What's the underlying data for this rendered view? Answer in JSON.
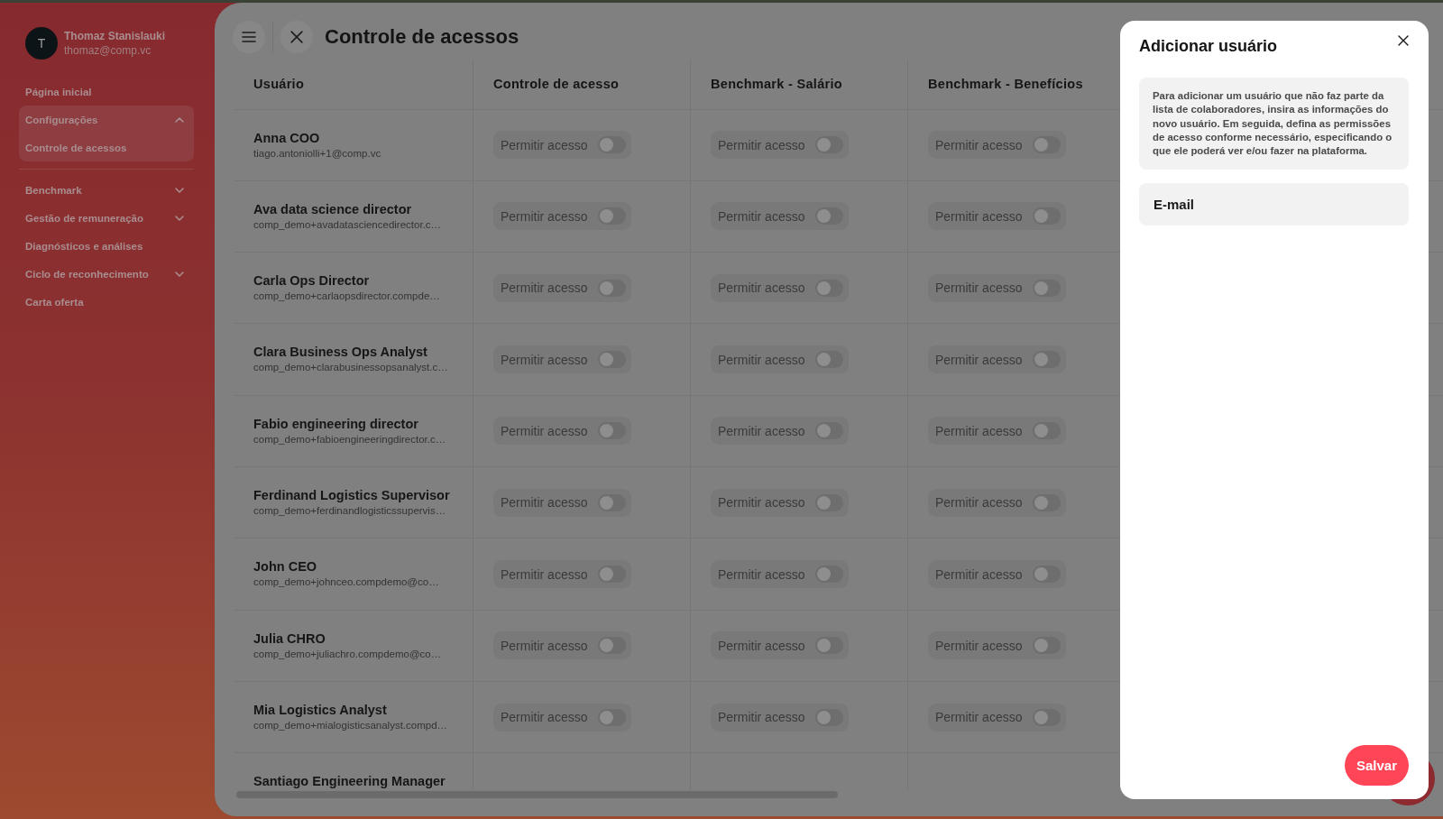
{
  "sidebar": {
    "user": {
      "initial": "T",
      "name": "Thomaz Stanislauki",
      "email": "thomaz@comp.vc"
    },
    "sections": [
      {
        "items": [
          {
            "kind": "link",
            "label": "Página inicial"
          },
          {
            "kind": "group",
            "label": "Configurações",
            "expanded": true,
            "children": [
              {
                "label": "Controle de acessos"
              }
            ]
          }
        ]
      },
      {
        "items": [
          {
            "kind": "group",
            "label": "Benchmark",
            "expanded": false
          },
          {
            "kind": "group",
            "label": "Gestão de remuneração",
            "expanded": false
          },
          {
            "kind": "link",
            "label": "Diagnósticos e análises"
          },
          {
            "kind": "group",
            "label": "Ciclo de reconhecimento",
            "expanded": false
          },
          {
            "kind": "link",
            "label": "Carta oferta"
          }
        ]
      }
    ]
  },
  "header": {
    "title": "Controle de acessos"
  },
  "table": {
    "columns": [
      "Usuário",
      "Controle de acesso",
      "Benchmark - Salário",
      "Benchmark - Benefícios"
    ],
    "rows": [
      {
        "name": "Anna COO",
        "email": "tiago.antoniolli+1@comp.vc",
        "permissions": [
          {
            "label": "Permitir acesso",
            "on": false
          },
          {
            "label": "Permitir acesso",
            "on": false
          },
          {
            "label": "Permitir acesso",
            "on": false
          }
        ]
      },
      {
        "name": "Ava data science director",
        "email": "comp_demo+avadatasciencedirector.c…",
        "permissions": [
          {
            "label": "Permitir acesso",
            "on": false
          },
          {
            "label": "Permitir acesso",
            "on": false
          },
          {
            "label": "Permitir acesso",
            "on": false
          }
        ]
      },
      {
        "name": "Carla Ops Director",
        "email": "comp_demo+carlaopsdirector.compde…",
        "permissions": [
          {
            "label": "Permitir acesso",
            "on": false
          },
          {
            "label": "Permitir acesso",
            "on": false
          },
          {
            "label": "Permitir acesso",
            "on": false
          }
        ]
      },
      {
        "name": "Clara Business Ops Analyst",
        "email": "comp_demo+clarabusinessopsanalyst.c…",
        "permissions": [
          {
            "label": "Permitir acesso",
            "on": false
          },
          {
            "label": "Permitir acesso",
            "on": false
          },
          {
            "label": "Permitir acesso",
            "on": false
          }
        ]
      },
      {
        "name": "Fabio engineering director",
        "email": "comp_demo+fabioengineeringdirector.c…",
        "permissions": [
          {
            "label": "Permitir acesso",
            "on": false
          },
          {
            "label": "Permitir acesso",
            "on": false
          },
          {
            "label": "Permitir acesso",
            "on": false
          }
        ]
      },
      {
        "name": "Ferdinand Logistics Supervisor",
        "email": "comp_demo+ferdinandlogisticssupervis…",
        "permissions": [
          {
            "label": "Permitir acesso",
            "on": false
          },
          {
            "label": "Permitir acesso",
            "on": false
          },
          {
            "label": "Permitir acesso",
            "on": false
          }
        ]
      },
      {
        "name": "John CEO",
        "email": "comp_demo+johnceo.compdemo@co…",
        "permissions": [
          {
            "label": "Permitir acesso",
            "on": false
          },
          {
            "label": "Permitir acesso",
            "on": false
          },
          {
            "label": "Permitir acesso",
            "on": false
          }
        ]
      },
      {
        "name": "Julia CHRO",
        "email": "comp_demo+juliachro.compdemo@co…",
        "permissions": [
          {
            "label": "Permitir acesso",
            "on": false
          },
          {
            "label": "Permitir acesso",
            "on": false
          },
          {
            "label": "Permitir acesso",
            "on": false
          }
        ]
      },
      {
        "name": "Mia Logistics Analyst",
        "email": "comp_demo+mialogisticsanalyst.compd…",
        "permissions": [
          {
            "label": "Permitir acesso",
            "on": false
          },
          {
            "label": "Permitir acesso",
            "on": false
          },
          {
            "label": "Permitir acesso",
            "on": false
          }
        ]
      },
      {
        "name": "Santiago Engineering Manager"
      }
    ]
  },
  "modal": {
    "title": "Adicionar usuário",
    "info": "Para adicionar um usuário que não faz parte da lista de colaboradores, insira as informações do novo usuário. Em seguida, defina as permissões de acesso conforme necessário, especificando o que ele poderá ver e/ou fazer na plataforma.",
    "email_field": {
      "placeholder": "E-mail"
    },
    "save_button": "Salvar"
  }
}
